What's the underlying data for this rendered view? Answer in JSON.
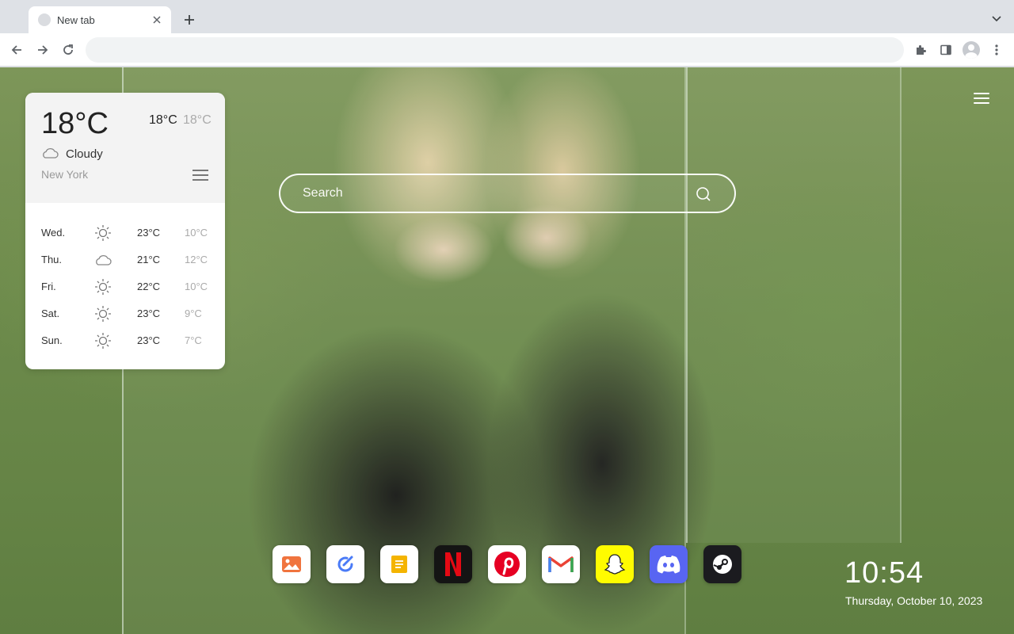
{
  "browser": {
    "tab": {
      "title": "New tab"
    },
    "omnibox": {
      "value": ""
    }
  },
  "weather": {
    "current": {
      "temp": "18°C",
      "high": "18°C",
      "low": "18°C",
      "condition": "Cloudy",
      "condition_icon": "cloud-icon",
      "city": "New York"
    },
    "forecast": [
      {
        "day": "Wed.",
        "icon": "sun-icon",
        "high": "23°C",
        "low": "10°C"
      },
      {
        "day": "Thu.",
        "icon": "cloud-icon",
        "high": "21°C",
        "low": "12°C"
      },
      {
        "day": "Fri.",
        "icon": "sun-icon",
        "high": "22°C",
        "low": "10°C"
      },
      {
        "day": "Sat.",
        "icon": "sun-icon",
        "high": "23°C",
        "low": "9°C"
      },
      {
        "day": "Sun.",
        "icon": "sun-icon",
        "high": "23°C",
        "low": "7°C"
      }
    ]
  },
  "search": {
    "placeholder": "Search"
  },
  "dock": {
    "apps": [
      {
        "name": "Photos",
        "icon": "photos-icon",
        "color": "#f0743e"
      },
      {
        "name": "Tasks",
        "icon": "tasks-icon",
        "color": "#4a7bf7"
      },
      {
        "name": "Notes",
        "icon": "notes-icon",
        "color": "#f4b400"
      },
      {
        "name": "Netflix",
        "icon": "netflix-icon",
        "color": "#e50914"
      },
      {
        "name": "Pinterest",
        "icon": "pinterest-icon",
        "color": "#e60023"
      },
      {
        "name": "Gmail",
        "icon": "gmail-icon",
        "color": "#ea4335"
      },
      {
        "name": "Snapchat",
        "icon": "snapchat-icon",
        "color": "#fffc00"
      },
      {
        "name": "Discord",
        "icon": "discord-icon",
        "color": "#5865f2"
      },
      {
        "name": "Steam",
        "icon": "steam-icon",
        "color": "#1b1b1f"
      }
    ]
  },
  "clock": {
    "time": "10:54",
    "date": "Thursday, October 10, 2023"
  }
}
